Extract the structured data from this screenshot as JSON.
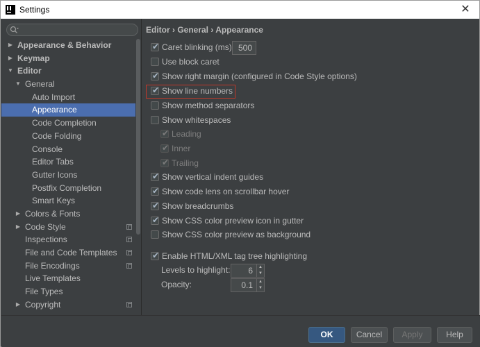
{
  "window": {
    "title": "Settings",
    "close_glyph": "✕"
  },
  "search": {
    "placeholder": ""
  },
  "tree": [
    {
      "label": "Appearance & Behavior",
      "bold": true,
      "arrow": "▶"
    },
    {
      "label": "Keymap",
      "bold": true,
      "arrow": "▶"
    },
    {
      "label": "Editor",
      "bold": true,
      "arrow": "▼"
    },
    {
      "label": "General",
      "arrow": "▼"
    },
    {
      "label": "Auto Import"
    },
    {
      "label": "Appearance",
      "selected": true
    },
    {
      "label": "Code Completion"
    },
    {
      "label": "Code Folding"
    },
    {
      "label": "Console"
    },
    {
      "label": "Editor Tabs"
    },
    {
      "label": "Gutter Icons"
    },
    {
      "label": "Postfix Completion"
    },
    {
      "label": "Smart Keys"
    },
    {
      "label": "Colors & Fonts",
      "arrow": "▶"
    },
    {
      "label": "Code Style",
      "arrow": "▶",
      "project_icon": true
    },
    {
      "label": "Inspections",
      "project_icon": true
    },
    {
      "label": "File and Code Templates",
      "project_icon": true
    },
    {
      "label": "File Encodings",
      "project_icon": true
    },
    {
      "label": "Live Templates"
    },
    {
      "label": "File Types"
    },
    {
      "label": "Copyright",
      "arrow": "▶",
      "project_icon": true
    }
  ],
  "breadcrumb": "Editor › General › Appearance",
  "options": {
    "caret_blinking": {
      "label": "Caret blinking (ms):",
      "checked": true,
      "value": "500"
    },
    "block_caret": {
      "label": "Use block caret",
      "checked": false
    },
    "right_margin": {
      "label": "Show right margin (configured in Code Style options)",
      "checked": true
    },
    "line_numbers": {
      "label": "Show line numbers",
      "checked": true
    },
    "method_separators": {
      "label": "Show method separators",
      "checked": false
    },
    "whitespaces": {
      "label": "Show whitespaces",
      "checked": false
    },
    "leading": {
      "label": "Leading",
      "checked": true,
      "disabled": true
    },
    "inner": {
      "label": "Inner",
      "checked": true,
      "disabled": true
    },
    "trailing": {
      "label": "Trailing",
      "checked": true,
      "disabled": true
    },
    "indent_guides": {
      "label": "Show vertical indent guides",
      "checked": true
    },
    "code_lens": {
      "label": "Show code lens on scrollbar hover",
      "checked": true
    },
    "breadcrumbs": {
      "label": "Show breadcrumbs",
      "checked": true
    },
    "css_gutter": {
      "label": "Show CSS color preview icon in gutter",
      "checked": true
    },
    "css_background": {
      "label": "Show CSS color preview as background",
      "checked": false
    },
    "tag_tree": {
      "label": "Enable HTML/XML tag tree highlighting",
      "checked": true
    },
    "levels": {
      "label": "Levels to highlight:",
      "value": "6"
    },
    "opacity": {
      "label": "Opacity:",
      "value": "0.1"
    }
  },
  "checkmark": "✔",
  "spinner": {
    "up": "▲",
    "down": "▼"
  },
  "buttons": {
    "ok": "OK",
    "cancel": "Cancel",
    "apply": "Apply",
    "help": "Help"
  },
  "colors": {
    "background": "#3c3f41",
    "selection": "#4b6eaf",
    "text": "#bbbbbb",
    "highlight_border": "#c0392b",
    "primary_button": "#365880"
  },
  "icons": {
    "app": "intellij-app-icon",
    "search": "search-icon",
    "close": "close-icon",
    "project": "project-level-icon"
  }
}
